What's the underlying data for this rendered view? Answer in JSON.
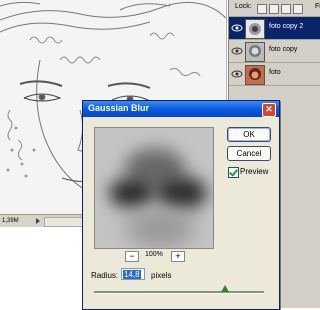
{
  "document": {
    "status_size": "1,39M"
  },
  "layers_panel": {
    "lock_label": "Lock:",
    "fill_label": "Fi",
    "layers": [
      {
        "name": "foto copy 2",
        "selected": true
      },
      {
        "name": "foto copy",
        "selected": false
      },
      {
        "name": "foto",
        "selected": false
      }
    ]
  },
  "dialog": {
    "title": "Gaussian Blur",
    "ok_label": "OK",
    "cancel_label": "Cancel",
    "preview_label": "Preview",
    "preview_checked": true,
    "zoom_level": "100%",
    "zoom_out_symbol": "−",
    "zoom_in_symbol": "+",
    "radius_label": "Radius:",
    "radius_value": "14,8",
    "radius_unit": "pixels",
    "radius_slider_fraction": 0.77,
    "close_symbol": "✕"
  },
  "colors": {
    "title_bar": "#0a5ae0",
    "selected_layer": "#0a246a",
    "dialog_bg": "#ece9d8"
  }
}
